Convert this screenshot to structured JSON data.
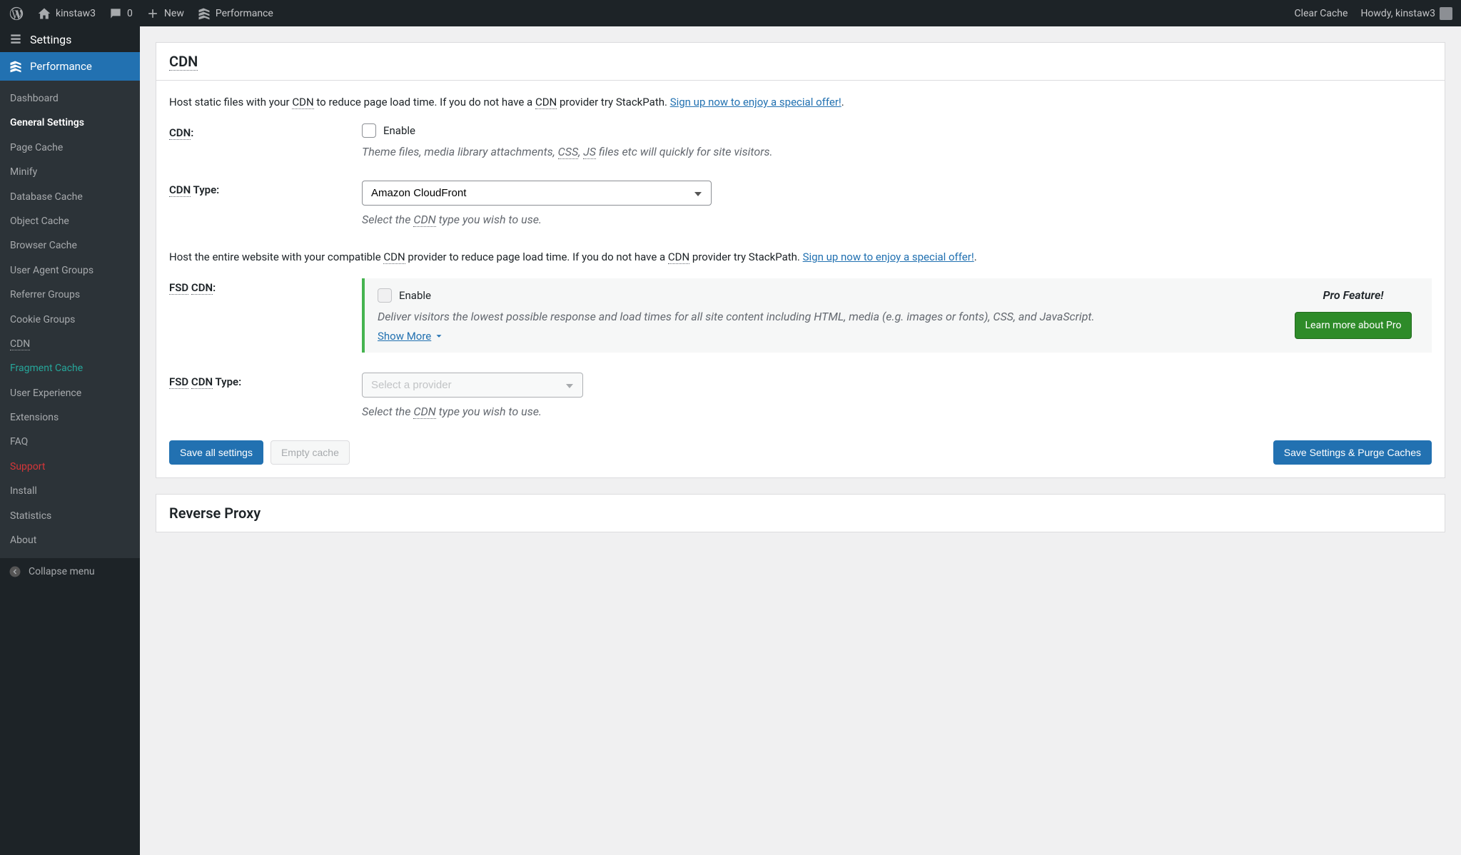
{
  "adminbar": {
    "site": "kinstaw3",
    "comments": "0",
    "new": "New",
    "performance": "Performance",
    "clear_cache": "Clear Cache",
    "howdy": "Howdy, kinstaw3"
  },
  "sidebar": {
    "settings": "Settings",
    "parent": "Performance",
    "items": {
      "dashboard": "Dashboard",
      "general": "General Settings",
      "page_cache": "Page Cache",
      "minify": "Minify",
      "db_cache": "Database Cache",
      "object_cache": "Object Cache",
      "browser_cache": "Browser Cache",
      "ua_groups": "User Agent Groups",
      "referrer_groups": "Referrer Groups",
      "cookie_groups": "Cookie Groups",
      "cdn": "CDN",
      "fragment_cache": "Fragment Cache",
      "user_experience": "User Experience",
      "extensions": "Extensions",
      "faq": "FAQ",
      "support": "Support",
      "install": "Install",
      "statistics": "Statistics",
      "about": "About"
    },
    "collapse": "Collapse menu"
  },
  "cdn": {
    "title": "CDN",
    "intro_pre": "Host static files with your ",
    "intro_post": " to reduce page load time. If you do not have a ",
    "intro_post2": " provider try StackPath. ",
    "signup": "Sign up now to enjoy a special offer!",
    "label": "CDN",
    "enable": "Enable",
    "desc_pre": "Theme files, media library attachments, ",
    "desc_css": "CSS",
    "desc_js": "JS",
    "desc_post": " files etc will quickly for site visitors.",
    "type_label_post": " Type:",
    "type_value": "Amazon CloudFront",
    "type_desc_pre": "Select the ",
    "type_desc_post": " type you wish to use.",
    "fsd_intro_pre": "Host the entire website with your compatible ",
    "fsd_intro_post": " provider to reduce page load time. If you do not have a ",
    "fsd_intro_post2": " provider try StackPath. ",
    "fsd_label_pre": "FSD",
    "fsd_label_mid": " ",
    "fsd_desc": "Deliver visitors the lowest possible response and load times for all site content including HTML, media (e.g. images or fonts), CSS, and JavaScript.",
    "show_more": "Show More",
    "pro_feature": "Pro Feature!",
    "learn_pro": "Learn more about Pro",
    "fsd_type_label_pre": "FSD",
    "fsd_type_label_mid": " ",
    "fsd_type_label_post": " Type:",
    "fsd_type_placeholder": "Select a provider"
  },
  "buttons": {
    "save_all": "Save all settings",
    "empty_cache": "Empty cache",
    "save_purge": "Save Settings & Purge Caches"
  },
  "reverse_proxy": {
    "title": "Reverse Proxy"
  },
  "abbr": {
    "cdn": "CDN",
    "css": "CSS",
    "js": "JS",
    "fsd": "FSD"
  }
}
